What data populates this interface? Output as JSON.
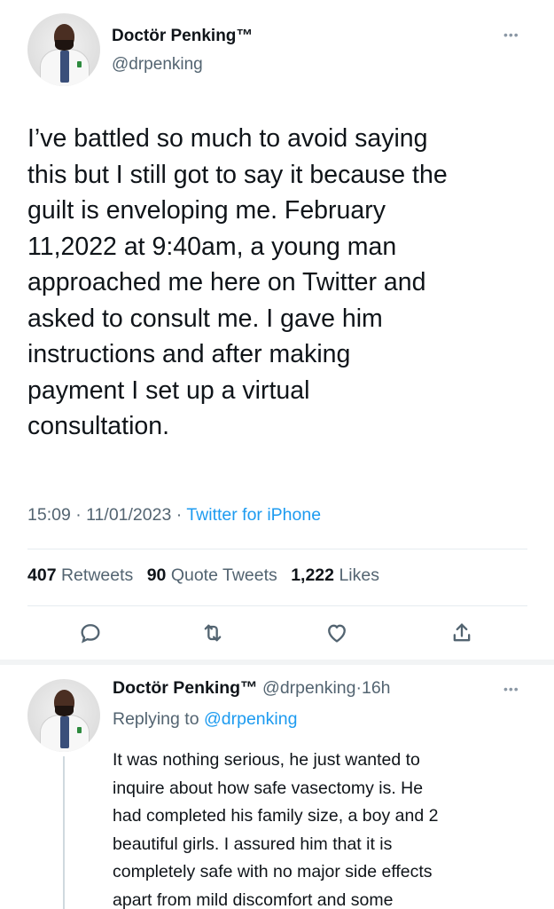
{
  "main_tweet": {
    "author_name": "Doctör Penking™",
    "author_handle": "@drpenking",
    "more_icon": "more-dots-icon",
    "text": "I’ve battled so much to avoid saying\nthis but I still got to say it because the\nguilt is enveloping me. February\n11,2022 at 9:40am, a young man\napproached me here on Twitter and\nasked to consult me. I gave him\ninstructions and after making\npayment I set up a virtual\nconsultation.",
    "time": "15:09",
    "date": "11/01/2023",
    "separator": "·",
    "source": "Twitter for iPhone",
    "stats": {
      "retweets_count": "407",
      "retweets_label": "Retweets",
      "quotes_count": "90",
      "quotes_label": "Quote Tweets",
      "likes_count": "1,222",
      "likes_label": "Likes"
    },
    "actions": [
      "reply-icon",
      "retweet-icon",
      "like-icon",
      "share-icon"
    ]
  },
  "reply_tweet": {
    "author_name": "Doctör Penking™",
    "author_handle": "@drpenking",
    "separator": "·",
    "age": "16h",
    "replying_label": "Replying to",
    "replying_to": "@drpenking",
    "text": "It was nothing serious, he just wanted to\ninquire about how safe vasectomy is. He\nhad completed his family size, a boy and 2\nbeautiful girls. I assured him that it is\ncompletely safe with no major side effects\napart from mild discomfort and some"
  },
  "colors": {
    "text": "#0f1419",
    "secondary": "#536471",
    "accent": "#1d9bf0",
    "divider": "#e6ecf0"
  }
}
